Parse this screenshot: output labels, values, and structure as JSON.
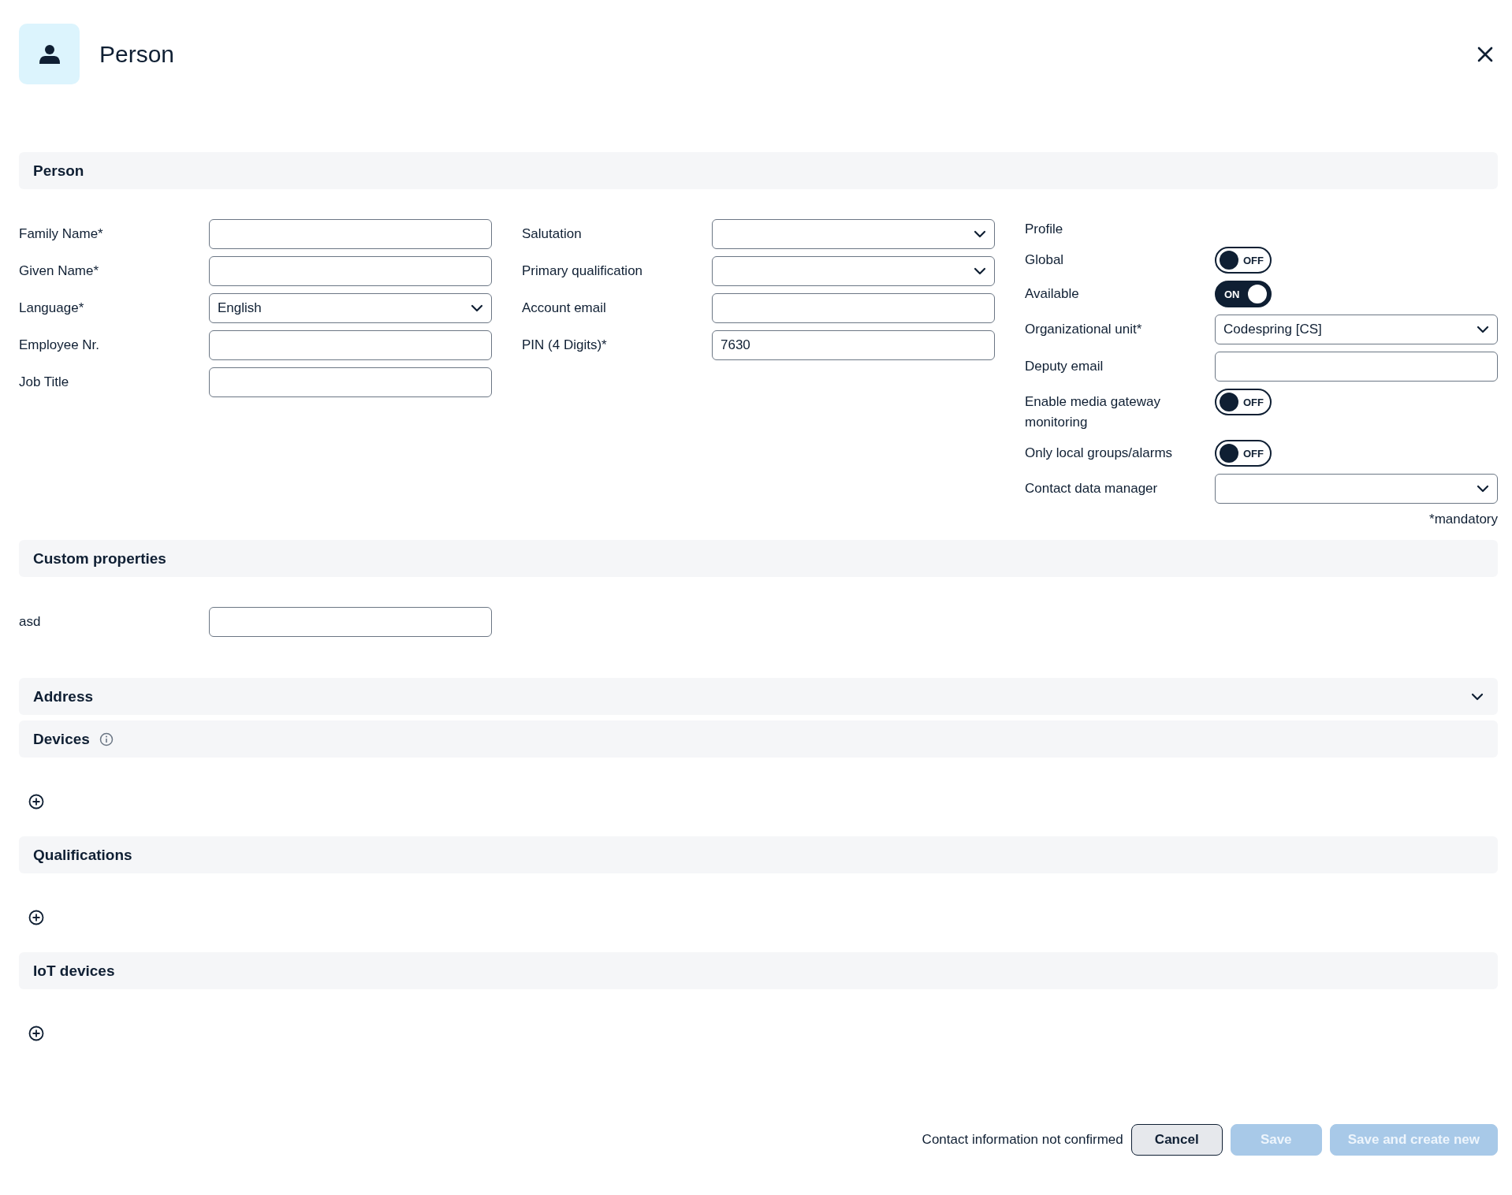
{
  "header": {
    "title": "Person"
  },
  "sections": [
    {
      "kind": "form",
      "title": "Person",
      "note": "*mandatory",
      "columns": [
        [
          {
            "kind": "text",
            "label": "Family Name*"
          },
          {
            "kind": "text",
            "label": "Given Name*"
          },
          {
            "kind": "select",
            "label": "Language*",
            "value": "English"
          },
          {
            "kind": "text",
            "label": "Employee Nr."
          },
          {
            "kind": "text",
            "label": "Job Title"
          }
        ],
        [
          {
            "kind": "select",
            "label": "Salutation"
          },
          {
            "kind": "select",
            "label": "Primary qualification"
          },
          {
            "kind": "text",
            "label": "Account email"
          },
          {
            "kind": "text",
            "label": "PIN (4 Digits)*",
            "value": "7630"
          }
        ],
        [
          {
            "kind": "heading",
            "label": "Profile"
          },
          {
            "kind": "toggle",
            "label": "Global",
            "on": false,
            "text": "OFF"
          },
          {
            "kind": "toggle",
            "label": "Available",
            "on": true,
            "text": "ON"
          },
          {
            "kind": "select",
            "label": "Organizational unit*",
            "value": "Codespring [CS]"
          },
          {
            "kind": "text",
            "label": "Deputy email"
          },
          {
            "kind": "toggle",
            "label": "Enable media gateway monitoring",
            "on": false,
            "text": "OFF"
          },
          {
            "kind": "toggle",
            "label": "Only local groups/alarms",
            "on": false,
            "text": "OFF"
          },
          {
            "kind": "select",
            "label": "Contact data manager"
          }
        ]
      ]
    },
    {
      "kind": "form",
      "title": "Custom properties",
      "columns": [
        [
          {
            "kind": "text",
            "label": "asd"
          }
        ]
      ]
    },
    {
      "kind": "collapsible",
      "title": "Address",
      "expanded": false
    },
    {
      "kind": "list",
      "title": "Devices",
      "info": true
    },
    {
      "kind": "list",
      "title": "Qualifications",
      "info": false
    },
    {
      "kind": "list",
      "title": "IoT devices",
      "info": false
    }
  ],
  "footer": {
    "status": "Contact information not confirmed",
    "buttons": [
      {
        "label": "Cancel",
        "disabled": false
      },
      {
        "label": "Save",
        "disabled": true
      },
      {
        "label": "Save and create new",
        "disabled": true
      }
    ]
  }
}
